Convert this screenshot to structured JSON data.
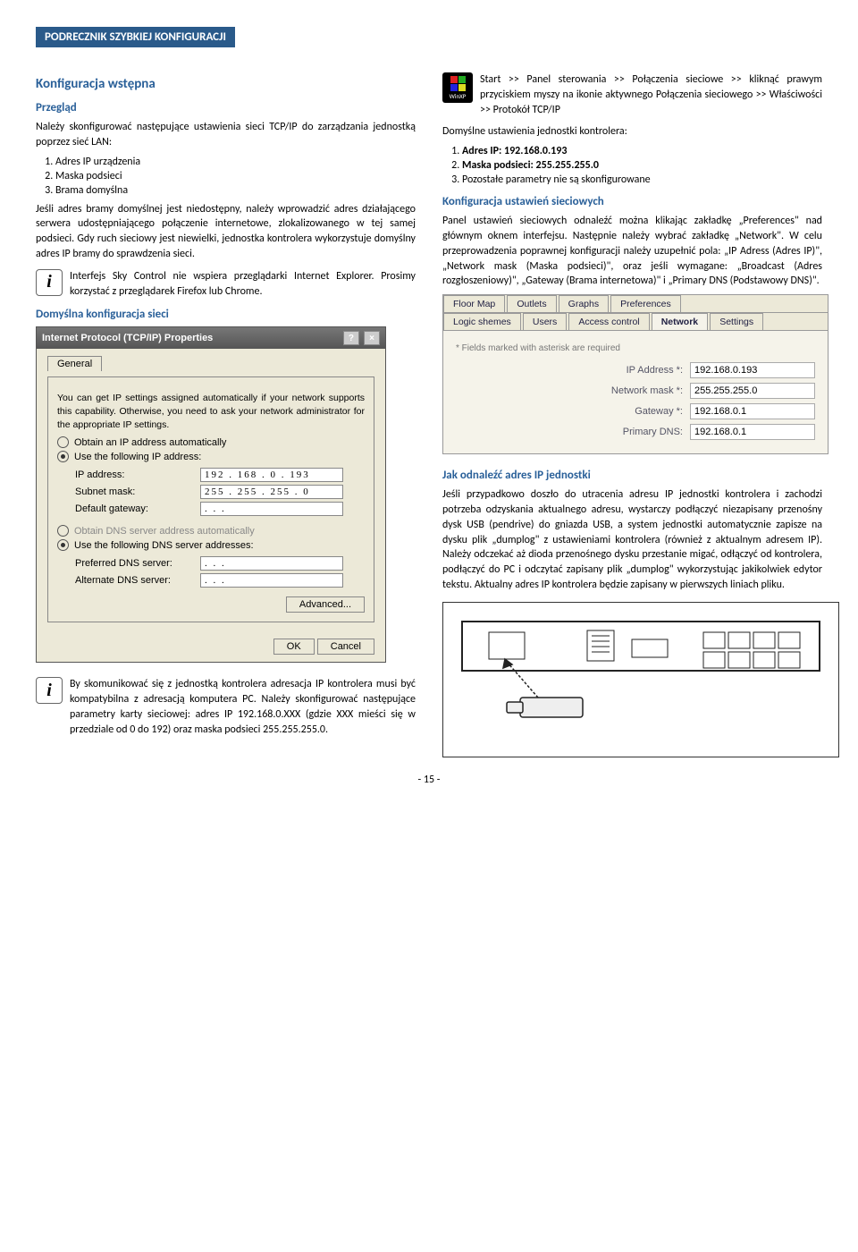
{
  "header": "PODRECZNIK SZYBKIEJ KONFIGURACJI",
  "left": {
    "title1": "Konfiguracja wstępna",
    "subtitle1": "Przegląd",
    "intro": "Należy skonfigurować następujące ustawienia sieci TCP/IP do zarządzania jednostką poprzez sieć LAN:",
    "list1": [
      "Adres IP urządzenia",
      "Maska podsieci",
      "Brama domyślna"
    ],
    "para2": "Jeśli adres bramy domyślnej jest niedostępny, należy wprowadzić adres działającego serwera udostępniającego połączenie internetowe, zlokalizowanego w tej samej podsieci. Gdy ruch sieciowy jest niewielki, jednostka kontrolera wykorzystuje domyślny adres IP bramy do sprawdzenia sieci.",
    "info1": "Interfejs Sky Control nie wspiera przeglądarki Internet Explorer. Prosimy korzystać z przeglądarek Firefox lub Chrome.",
    "subtitle2": "Domyślna konfiguracja sieci",
    "tcpip": {
      "window_title": "Internet Protocol (TCP/IP) Properties",
      "tab": "General",
      "desc": "You can get IP settings assigned automatically if your network supports this capability. Otherwise, you need to ask your network administrator for the appropriate IP settings.",
      "r1": "Obtain an IP address automatically",
      "r2": "Use the following IP address:",
      "ip_lbl": "IP address:",
      "ip_val": "192 . 168 .   0  . 193",
      "mask_lbl": "Subnet mask:",
      "mask_val": "255 . 255 . 255 .   0",
      "gw_lbl": "Default gateway:",
      "gw_val": " .       .       .",
      "r3": "Obtain DNS server address automatically",
      "r4": "Use the following DNS server addresses:",
      "pdns_lbl": "Preferred DNS server:",
      "adns_lbl": "Alternate DNS server:",
      "dns_val": " .       .       .",
      "advanced": "Advanced...",
      "ok": "OK",
      "cancel": "Cancel"
    },
    "info2": "By skomunikować się z jednostką kontrolera adresacja IP kontrolera musi być kompatybilna z adresacją komputera PC. Należy skonfigurować następujące parametry karty sieciowej: adres IP 192.168.0.XXX (gdzie XXX mieści się w przedziale od 0 do 192) oraz maska podsieci 255.255.255.0."
  },
  "right": {
    "winxp_label": "WinXP",
    "winxp_text": "Start >> Panel sterowania >> Połączenia sieciowe >> kliknąć prawym przyciskiem myszy na ikonie aktywnego Połączenia sieciowego >> Właściwości >> Protokół TCP/IP",
    "defaults_lbl": "Domyślne ustawienia jednostki kontrolera:",
    "list2": [
      "Adres IP: 192.168.0.193",
      "Maska podsieci: 255.255.255.0",
      "Pozostałe parametry nie są skonfigurowane"
    ],
    "title2": "Konfiguracja ustawień sieciowych",
    "para3": "Panel ustawień sieciowych odnaleźć można klikając zakładkę „Preferences\" nad głównym oknem interfejsu. Następnie należy wybrać zakładkę „Network\". W celu przeprowadzenia poprawnej konfiguracji należy uzupełnić pola: „IP Adress (Adres IP)\", „Network mask (Maska podsieci)\", oraz jeśli wymagane: „Broadcast (Adres rozgłoszeniowy)\", „Gateway (Brama internetowa)\" i „Primary DNS (Podstawowy DNS)\".",
    "prefs": {
      "tabs_row1": [
        "Floor Map",
        "Outlets",
        "Graphs",
        "Preferences"
      ],
      "tabs_row2": [
        "Logic shemes",
        "Users",
        "Access control",
        "Network",
        "Settings"
      ],
      "req": "* Fields marked with asterisk are required",
      "ip_lbl": "IP Address *:",
      "ip_val": "192.168.0.193",
      "mask_lbl": "Network mask *:",
      "mask_val": "255.255.255.0",
      "gw_lbl": "Gateway *:",
      "gw_val": "192.168.0.1",
      "dns_lbl": "Primary DNS:",
      "dns_val": "192.168.0.1"
    },
    "title3": "Jak odnaleźć adres IP jednostki",
    "para4": "Jeśli przypadkowo doszło do utracenia adresu IP jednostki kontrolera i zachodzi potrzeba odzyskania aktualnego adresu, wystarczy podłączyć niezapisany przenośny dysk USB (pendrive) do gniazda USB, a system jednostki automatycznie zapisze na dysku plik „dumplog\" z ustawieniami kontrolera (również z aktualnym adresem IP). Należy odczekać aż dioda przenośnego dysku przestanie migać, odłączyć od kontrolera, podłączyć do PC i odczytać zapisany plik „dumplog\" wykorzystując jakikolwiek edytor tekstu. Aktualny adres IP kontrolera będzie zapisany w pierwszych liniach pliku."
  },
  "page_number": "- 15 -"
}
